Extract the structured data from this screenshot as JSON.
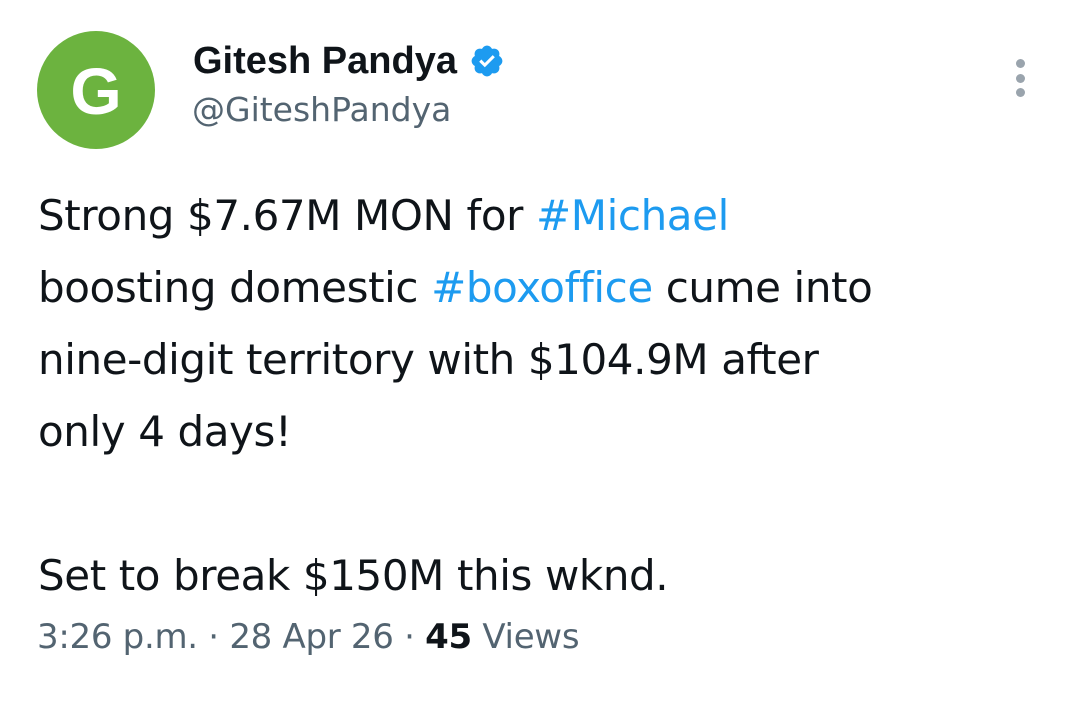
{
  "author": {
    "avatar_letter": "G",
    "display_name": "Gitesh Pandya",
    "handle": "@GiteshPandya",
    "verified": true
  },
  "more_menu": {
    "icon": "more-vertical-icon"
  },
  "tweet": {
    "lines": [
      [
        {
          "text": "Strong $7.67M MON for ",
          "hashtag": false
        },
        {
          "text": "#Michael",
          "hashtag": true
        }
      ],
      [
        {
          "text": "boosting domestic ",
          "hashtag": false
        },
        {
          "text": "#boxoffice",
          "hashtag": true
        },
        {
          "text": " cume into",
          "hashtag": false
        }
      ],
      [
        {
          "text": "nine-digit territory with $104.9M after",
          "hashtag": false
        }
      ],
      [
        {
          "text": "only 4 days!",
          "hashtag": false
        }
      ]
    ],
    "second_paragraph": "Set to break $150M this wknd."
  },
  "meta": {
    "time": "3:26 p.m.",
    "separator1": " · ",
    "date": "28 Apr 26",
    "separator2": " · ",
    "views_count": "45",
    "views_label": " Views"
  },
  "colors": {
    "avatar_bg": "#6cb33f",
    "hashtag": "#1d9bf0",
    "verified_badge": "#1d9bf0",
    "secondary_text": "#536471",
    "primary_text": "#0f1419"
  }
}
